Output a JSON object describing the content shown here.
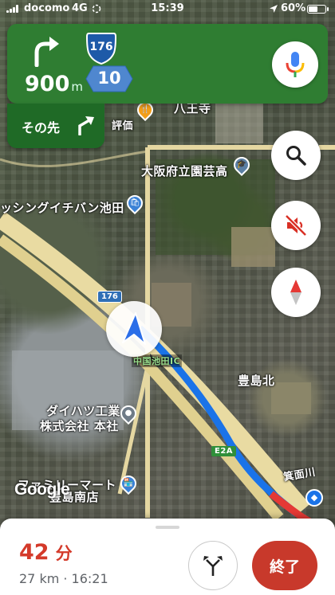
{
  "status_bar": {
    "carrier": "docomo",
    "network": "4G",
    "time": "15:39",
    "battery_percent": "60%",
    "battery_level": 0.6
  },
  "navigation": {
    "distance_value": "900",
    "distance_unit": "m",
    "route_number_top": "176",
    "route_number_bottom": "10",
    "then_label": "その先",
    "accent_color": "#2f7d32",
    "next_turn": "turn-right-icon",
    "then_turn": "slight-right-icon"
  },
  "map": {
    "labels": [
      "八王寺",
      "大阪府立園芸高",
      "ッシングイチバン池田",
      "中国池田IC",
      "豊島北",
      "ダイハツ工業",
      "株式会社 本社",
      "ファミリーマート",
      "豊島南店",
      "箕面川",
      "評価"
    ],
    "road_shields": [
      "176",
      "E2A"
    ],
    "attribution": "Google"
  },
  "trip": {
    "duration_value": "42",
    "duration_unit": "分",
    "details": "27 km · 16:21",
    "end_label": "終了",
    "end_color": "#c8392b"
  }
}
